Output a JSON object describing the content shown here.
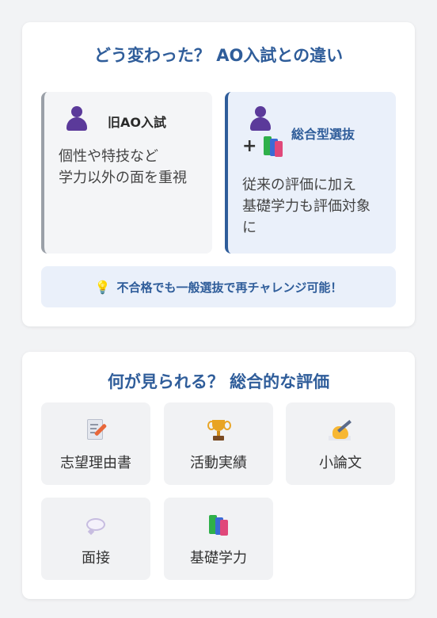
{
  "section1": {
    "title": "どう変わった？ AO入試との違い",
    "old": {
      "heading": "旧AO入試",
      "text_line1": "個性や特技など",
      "text_line2": "学力以外の面を重視",
      "icon": "person-icon"
    },
    "new": {
      "heading": "総合型選抜",
      "plus": "+",
      "text_line1": "従来の評価に加え",
      "text_line2": "基礎学力も評価対象",
      "text_line3": "に",
      "icons": [
        "person-icon",
        "books-icon"
      ]
    },
    "tip": {
      "icon": "lightbulb-icon",
      "text": "不合格でも一般選抜で再チャレンジ可能！"
    }
  },
  "section2": {
    "title": "何が見られる？ 総合的な評価",
    "items": [
      {
        "label": "志望理由書",
        "icon": "memo-icon"
      },
      {
        "label": "活動実績",
        "icon": "trophy-icon"
      },
      {
        "label": "小論文",
        "icon": "writing-hand-icon"
      },
      {
        "label": "面接",
        "icon": "speech-bubble-icon"
      },
      {
        "label": "基礎学力",
        "icon": "books-icon"
      }
    ]
  },
  "colors": {
    "accent": "#2f5d9a",
    "background": "#f2f3f5",
    "card": "#ffffff"
  }
}
